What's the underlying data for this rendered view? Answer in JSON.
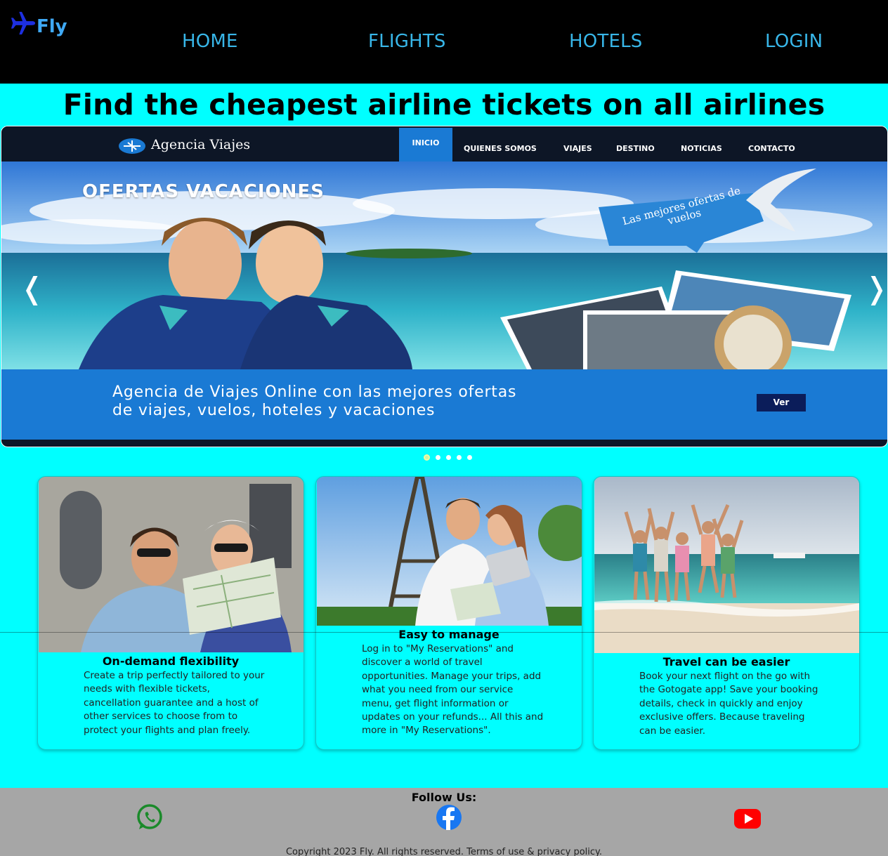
{
  "brand": {
    "name": "Fly",
    "icon": "airplane-icon"
  },
  "nav": {
    "home": "HOME",
    "flights": "FLIGHTS",
    "hotels": "HOTELS",
    "login": "LOGIN"
  },
  "headline": "Find the cheapest airline tickets on all airlines",
  "carousel": {
    "slide": {
      "logo_text": "Agencia Viajes",
      "menu": [
        "INICIO",
        "QUIENES SOMOS",
        "VIAJES",
        "DESTINO",
        "NOTICIAS",
        "CONTACTO"
      ],
      "headline": "OFERTAS VACACIONES",
      "tag": "Las mejores ofertas de vuelos",
      "caption_line1": "Agencia de Viajes Online con las mejores ofertas",
      "caption_line2": "de viajes, vuelos, hoteles y vacaciones",
      "button": "Ver"
    },
    "prev": "❬",
    "next": "❭",
    "slide_count": 5,
    "active_slide": 1
  },
  "cards": [
    {
      "title": "On-demand flexibility",
      "body": "Create a trip perfectly tailored to your needs with flexible tickets, cancellation guarantee and a host of other services to choose from to protect your flights and plan freely."
    },
    {
      "title": "Easy to manage",
      "body": "Log in to \"My Reservations\" and discover a world of travel opportunities. Manage your trips, add what you need from our service menu, get flight information or updates on your refunds... All this and more in \"My Reservations\"."
    },
    {
      "title": "Travel can be easier",
      "body": "Book your next flight on the go with the Gotogate app! Save your booking details, check in quickly and enjoy exclusive offers. Because traveling can be easier."
    }
  ],
  "footer": {
    "follow": "Follow Us:",
    "socials": [
      "whatsapp-icon",
      "facebook-icon",
      "youtube-icon"
    ],
    "copyright": "Copyright 2023 Fly. All rights reserved. Terms of use & privacy policy."
  },
  "colors": {
    "page_bg": "#00ffff",
    "nav_bg": "#000000",
    "nav_link": "#38b6e8",
    "footer_bg": "#a6a6a6",
    "whatsapp": "#1a8a2a",
    "facebook": "#1877f2",
    "youtube": "#ff0000"
  }
}
